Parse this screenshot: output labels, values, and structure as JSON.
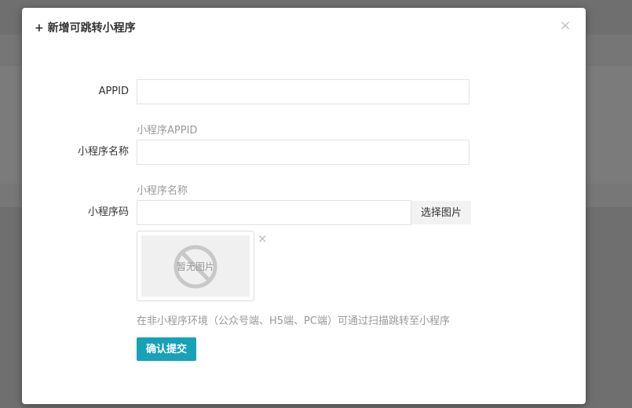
{
  "modal": {
    "title": "+ 新增可跳转小程序",
    "close_icon": "×"
  },
  "form": {
    "appid": {
      "label": "APPID",
      "value": "",
      "help": "小程序APPID"
    },
    "name": {
      "label": "小程序名称",
      "value": "",
      "help": "小程序名称"
    },
    "code": {
      "label": "小程序码",
      "value": "",
      "pick_button": "选择图片",
      "placeholder_image_text": "暂无图片",
      "remove_icon": "×",
      "tip": "在非小程序环境（公众号端、H5端、PC端）可通过扫描跳转至小程序"
    },
    "submit_label": "确认提交"
  },
  "colors": {
    "accent": "#17a2b8",
    "overlay": "#6f6f6f"
  }
}
